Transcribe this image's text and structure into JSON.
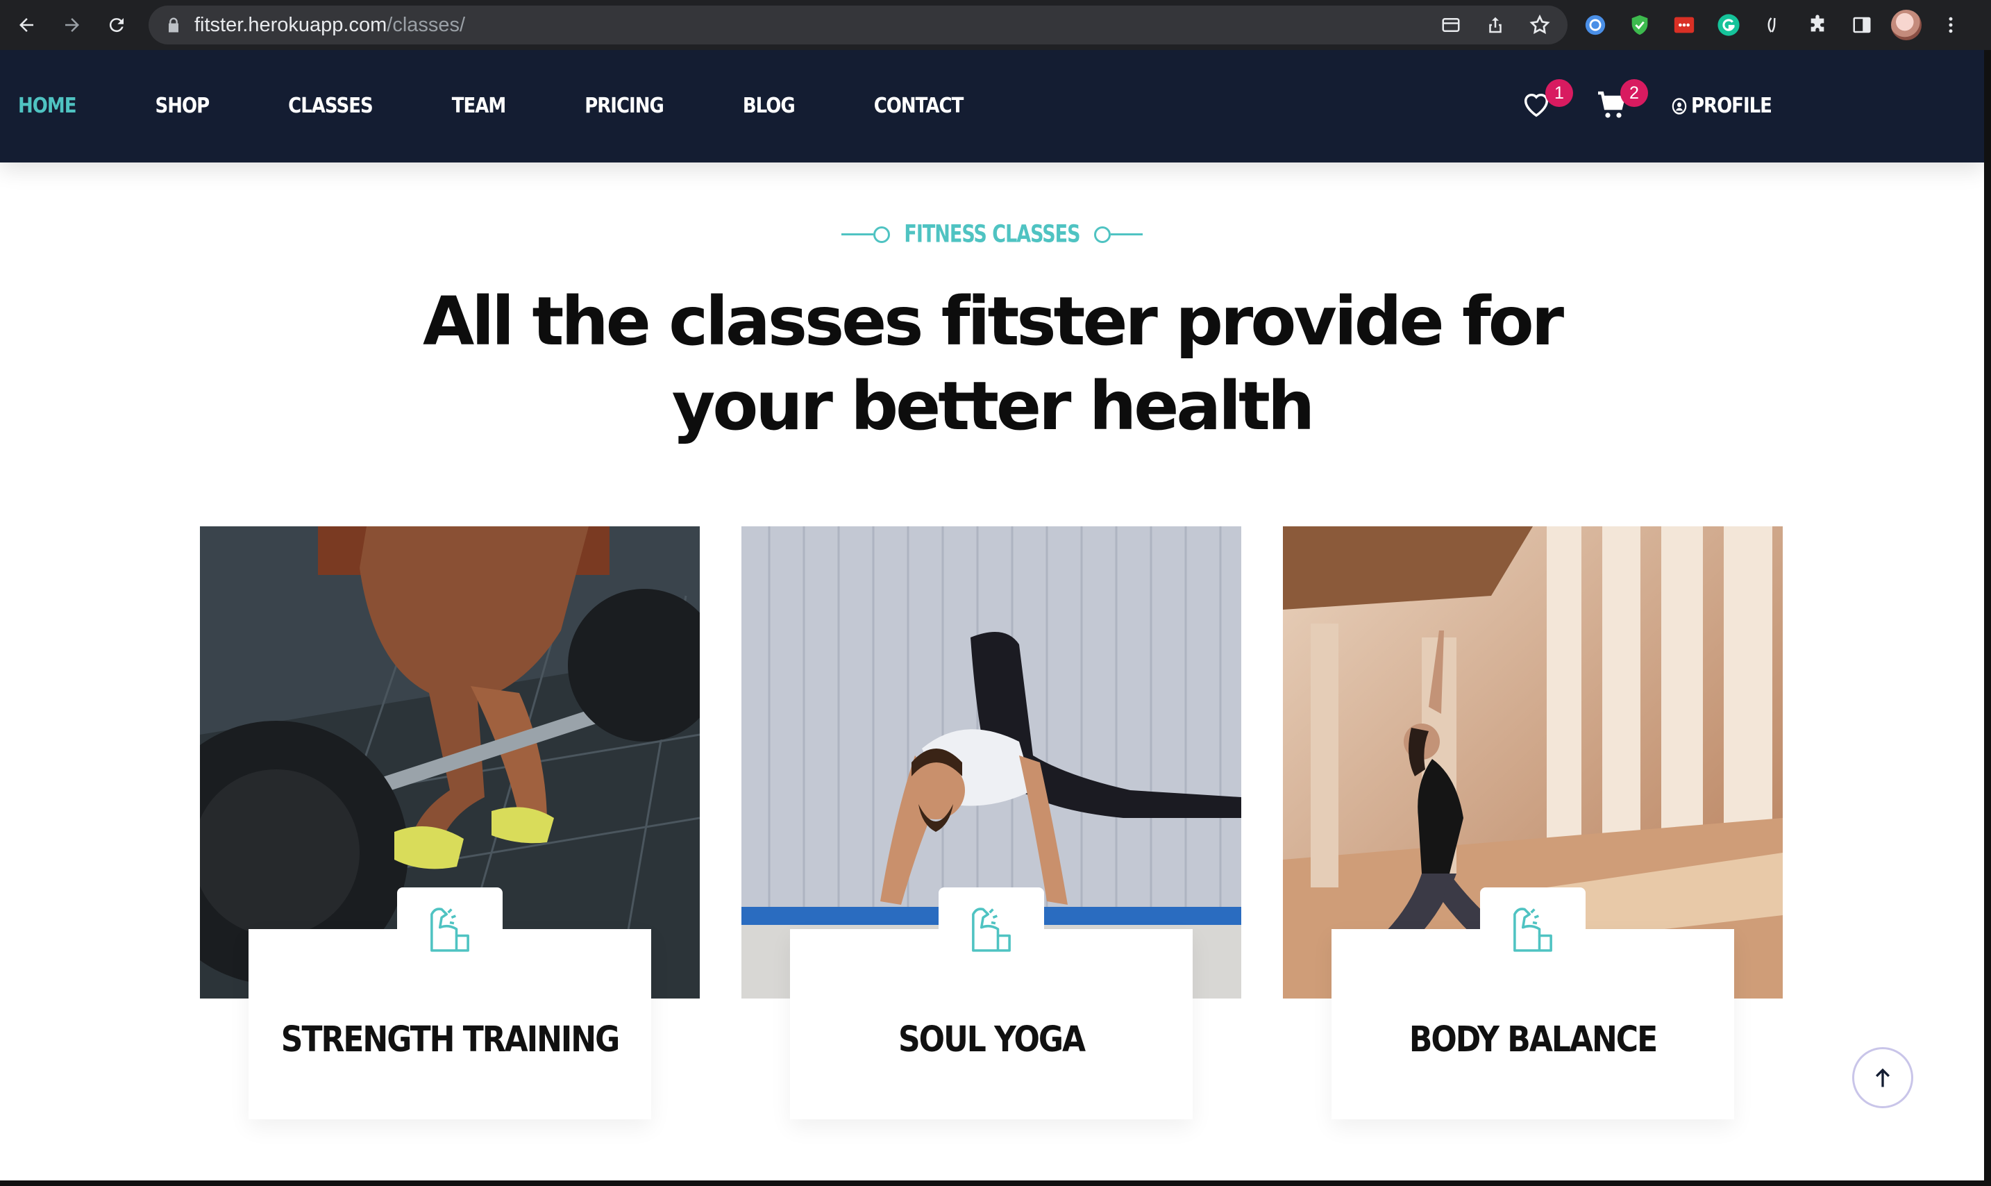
{
  "browser": {
    "url_host": "fitster.herokuapp.com",
    "url_path": "/classes/"
  },
  "nav": {
    "links": [
      {
        "label": "HOME",
        "active": true
      },
      {
        "label": "SHOP",
        "active": false
      },
      {
        "label": "CLASSES",
        "active": false
      },
      {
        "label": "TEAM",
        "active": false
      },
      {
        "label": "PRICING",
        "active": false
      },
      {
        "label": "BLOG",
        "active": false
      },
      {
        "label": "CONTACT",
        "active": false
      }
    ],
    "wishlist_count": "1",
    "cart_count": "2",
    "profile_label": "PROFILE"
  },
  "section": {
    "eyebrow": "FITNESS CLASSES",
    "headline_part1": "All the classes ",
    "headline_brand": "fitster",
    "headline_part2": " provide for",
    "headline_line2": "your better health"
  },
  "classes": [
    {
      "title": "STRENGTH TRAINING",
      "icon": "flexed-arm-icon"
    },
    {
      "title": "SOUL YOGA",
      "icon": "flexed-arm-icon"
    },
    {
      "title": "BODY BALANCE",
      "icon": "flexed-arm-icon"
    }
  ],
  "colors": {
    "accent": "#4fc3c2",
    "nav_bg": "#141d32",
    "badge": "#d81b60"
  }
}
